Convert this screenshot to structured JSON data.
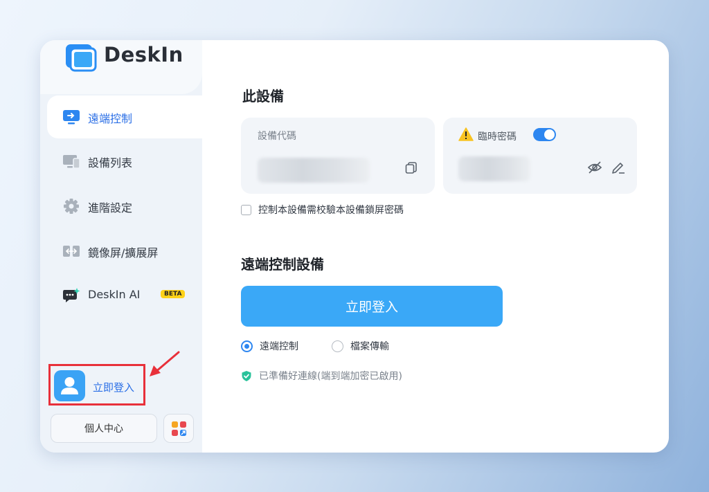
{
  "app": {
    "name": "DeskIn"
  },
  "colors": {
    "accent": "#2b6fe6",
    "primary_button": "#3aa8f7",
    "highlight_box": "#e8303a",
    "beta_badge": "#ffd21a"
  },
  "sidebar": {
    "items": [
      {
        "label": "遠端控制",
        "icon": "remote-control-icon",
        "active": true
      },
      {
        "label": "設備列表",
        "icon": "device-list-icon"
      },
      {
        "label": "進階設定",
        "icon": "gear-icon"
      },
      {
        "label": "鏡像屏/擴展屏",
        "icon": "mirror-screen-icon"
      },
      {
        "label": "DeskIn AI",
        "icon": "ai-chat-icon",
        "badge": "BETA"
      }
    ],
    "login_label": "立即登入",
    "profile_label": "個人中心",
    "apps_icon": "apps-grid-icon"
  },
  "main": {
    "device_title": "此設備",
    "device_code_label": "設備代碼",
    "temp_password_label": "臨時密碼",
    "temp_password_enabled": true,
    "lock_checkbox_label": "控制本設備需校驗本設備鎖屏密碼",
    "lock_checkbox_checked": false,
    "remote_title": "遠端控制設備",
    "login_button": "立即登入",
    "modes": [
      {
        "label": "遠端控制",
        "selected": true
      },
      {
        "label": "檔案傳輸",
        "selected": false
      }
    ],
    "status_text": "已準備好連線(端到端加密已啟用)"
  }
}
